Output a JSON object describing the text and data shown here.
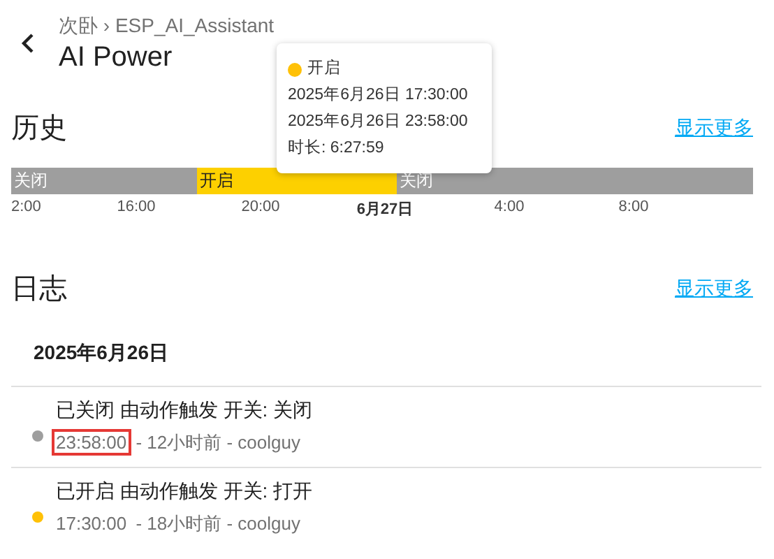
{
  "header": {
    "breadcrumb": "次卧 › ESP_AI_Assistant",
    "title": "AI Power"
  },
  "tooltip": {
    "state": "开启",
    "color": "#ffc107",
    "start": "2025年6月26日 17:30:00",
    "end": "2025年6月26日 23:58:00",
    "duration": "时长: 6:27:59"
  },
  "history": {
    "title": "历史",
    "more": "显示更多",
    "segments": [
      {
        "label": "关闭",
        "kind": "off"
      },
      {
        "label": "开启",
        "kind": "on"
      },
      {
        "label": "关闭",
        "kind": "off"
      }
    ],
    "ticks": [
      {
        "label": "2:00",
        "bold": false
      },
      {
        "label": "16:00",
        "bold": false
      },
      {
        "label": "20:00",
        "bold": false
      },
      {
        "label": "6月27日",
        "bold": true
      },
      {
        "label": "4:00",
        "bold": false
      },
      {
        "label": "8:00",
        "bold": false
      }
    ]
  },
  "logbook": {
    "title": "日志",
    "more": "显示更多",
    "date": "2025年6月26日",
    "entries": [
      {
        "message": "已关闭 由动作触发 开关: 关闭",
        "time": "23:58:00",
        "detail": " - 12小时前 - coolguy",
        "color": "#9e9e9e",
        "highlighted": true
      },
      {
        "message": "已开启 由动作触发 开关: 打开",
        "time": "17:30:00",
        "detail": " - 18小时前 - coolguy",
        "color": "#ffc107",
        "highlighted": false
      }
    ]
  }
}
